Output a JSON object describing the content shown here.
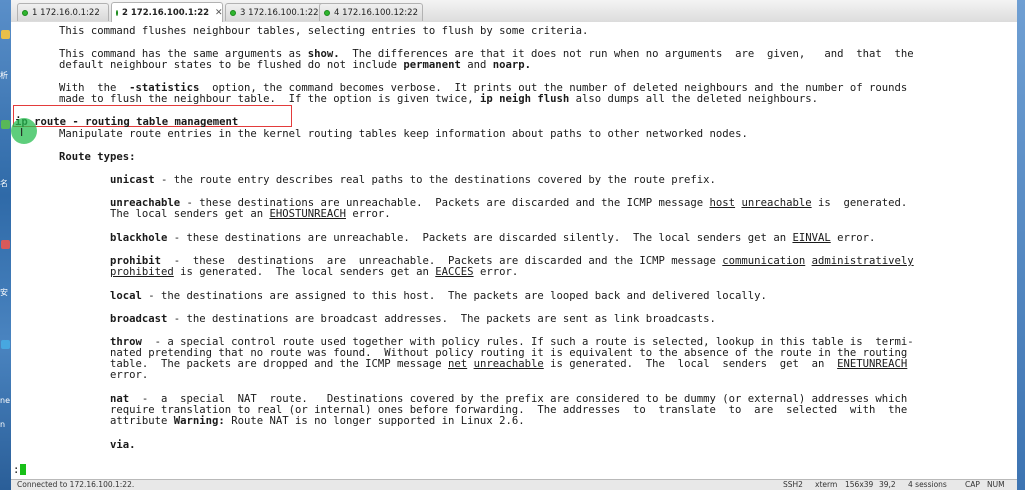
{
  "tabs": [
    {
      "label": "1 172.16.0.1:22",
      "active": false
    },
    {
      "label": "2 172.16.100.1:22",
      "active": true
    },
    {
      "label": "3 172.16.100.1:22",
      "active": false
    },
    {
      "label": "4 172.16.100.12:22",
      "active": false
    }
  ],
  "desktop_labels": [
    "析",
    "名",
    "安",
    "ne",
    "n"
  ],
  "terminal": {
    "l1": "This command flushes neighbour tables, selecting entries to flush by some criteria.",
    "l2a": "This command has the same arguments as ",
    "l2b": "show.",
    "l2c": "  The differences are that it does not run when no arguments  are  given,   and  that  the",
    "l3a": "default neighbour states to be flushed do not include ",
    "l3b": "permanent",
    "l3c": " and ",
    "l3d": "noarp.",
    "l4a": "With  the  ",
    "l4b": "-statistics",
    "l4c": "  option, the command becomes verbose.  It prints out the number of deleted neighbours and the number of rounds",
    "l5a": "made to flush the neighbour table.  If the option is given twice, ",
    "l5b": "ip neigh flush",
    "l5c": " also dumps all the deleted neighbours.",
    "sec_title": "ip route - routing table management",
    "sec_desc": "Manipulate route entries in the kernel routing tables keep information about paths to other networked nodes.",
    "route_types": "Route types:",
    "unicast_k": "unicast",
    "unicast_d": " - the route entry describes real paths to the destinations covered by the route prefix.",
    "unr_k": "unreachable",
    "unr_d1": " - these destinations are unreachable.  Packets are discarded and the ICMP message ",
    "unr_u1": "host",
    "unr_s1": " ",
    "unr_u2": "unreachable",
    "unr_d2": " is  generated.",
    "unr_l2a": "The local senders get an ",
    "unr_l2u": "EHOSTUNREACH",
    "unr_l2b": " error.",
    "bh_k": "blackhole",
    "bh_d1": " - these destinations are unreachable.  Packets are discarded silently.  The local senders get an ",
    "bh_u": "EINVAL",
    "bh_d2": " error.",
    "pr_k": "prohibit",
    "pr_d1": "  -  these  destinations  are  unreachable.  Packets are discarded and the ICMP message ",
    "pr_u1": "communication",
    "pr_s1": " ",
    "pr_u2": "administratively",
    "pr_l2u": "prohibited",
    "pr_l2a": " is generated.  The local senders get an ",
    "pr_l2u2": "EACCES",
    "pr_l2b": " error.",
    "lo_k": "local",
    "lo_d": " - the destinations are assigned to this host.  The packets are looped back and delivered locally.",
    "bc_k": "broadcast",
    "bc_d": " - the destinations are broadcast addresses.  The packets are sent as link broadcasts.",
    "th_k": "throw",
    "th_d1": "  - a special control route used together with policy rules. If such a route is selected, lookup in this table is  termi-",
    "th_l2": "nated pretending that no route was found.  Without policy routing it is equivalent to the absence of the route in the routing",
    "th_l3a": "table.  The packets are dropped and the ICMP message ",
    "th_l3u1": "net",
    "th_l3s": " ",
    "th_l3u2": "unreachable",
    "th_l3b": " is generated.  The  local  senders  get  an  ",
    "th_l3u3": "ENETUNREACH",
    "th_l4": "error.",
    "nat_k": "nat",
    "nat_d1": "  -  a  special  NAT  route.   Destinations covered by the prefix are considered to be dummy (or external) addresses which",
    "nat_l2": "require translation to real (or internal) ones before forwarding.  The addresses  to  translate  to  are  selected  with  the",
    "nat_l3a": "attribute ",
    "nat_l3b": "Warning:",
    "nat_l3c": " Route NAT is no longer supported in Linux 2.6.",
    "via": "via.",
    "prompt": ":"
  },
  "status": {
    "connected": "Connected to 172.16.100.1:22.",
    "proto": "SSH2",
    "term": "xterm",
    "size": "156x39",
    "pos": "39,2",
    "sessions": "4 sessions",
    "caps": "CAP",
    "num": "NUM"
  },
  "colors": {
    "highlight_box": "#e33b3b",
    "cursor_circle": "#28be50",
    "caret": "#18c018",
    "tab_dot": "#2fb52f"
  }
}
